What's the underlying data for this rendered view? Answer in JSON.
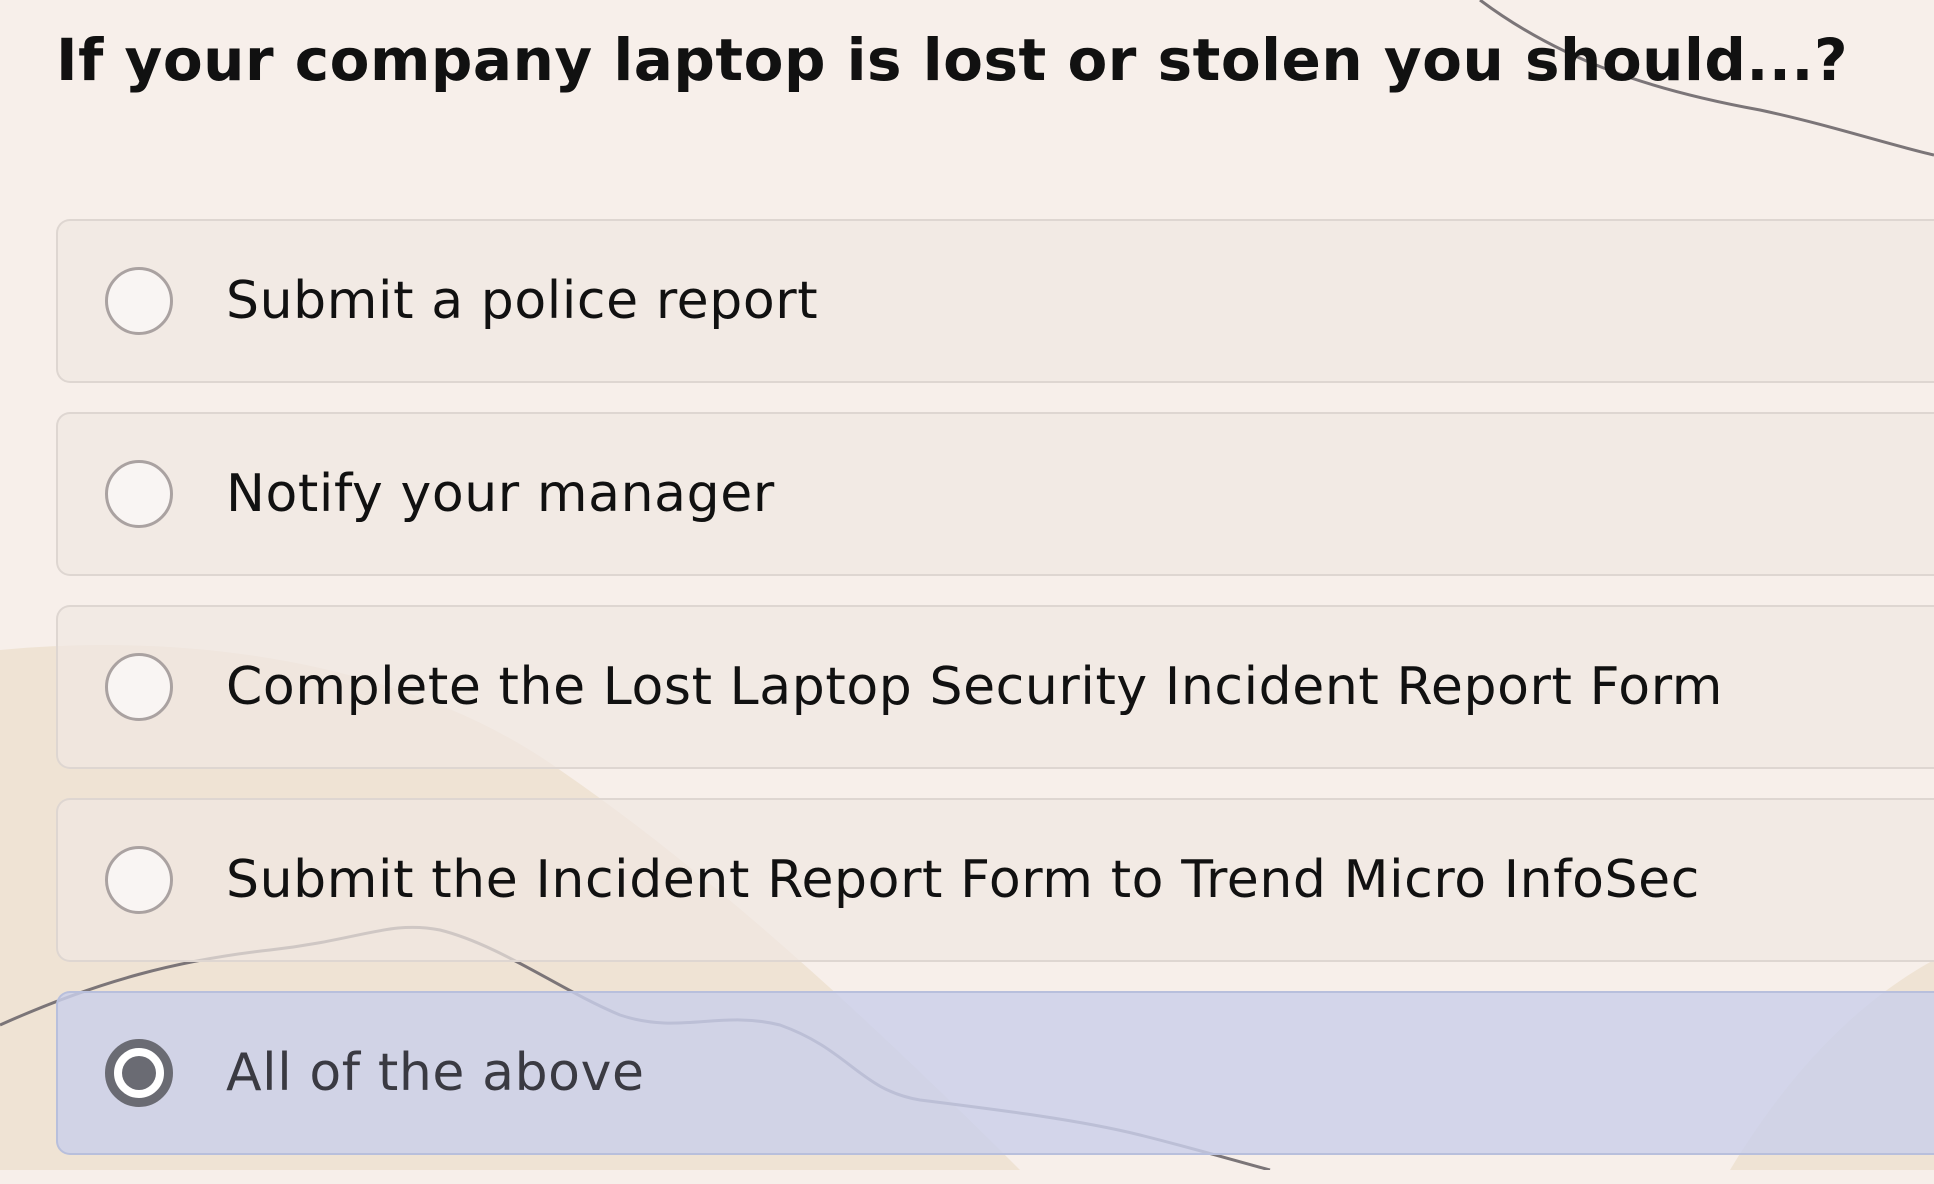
{
  "question": {
    "text": "If your company laptop is lost or stolen you should...?"
  },
  "options": [
    {
      "label": "Submit a police report",
      "selected": false
    },
    {
      "label": "Notify your manager",
      "selected": false
    },
    {
      "label": "Complete the Lost Laptop Security Incident Report Form",
      "selected": false
    },
    {
      "label": "Submit the Incident Report Form to Trend Micro InfoSec",
      "selected": false
    },
    {
      "label": "All of the above",
      "selected": true
    }
  ],
  "colors": {
    "background": "#f7efea",
    "selected_option": "#cbd0ea",
    "option": "#f0e7e2"
  }
}
